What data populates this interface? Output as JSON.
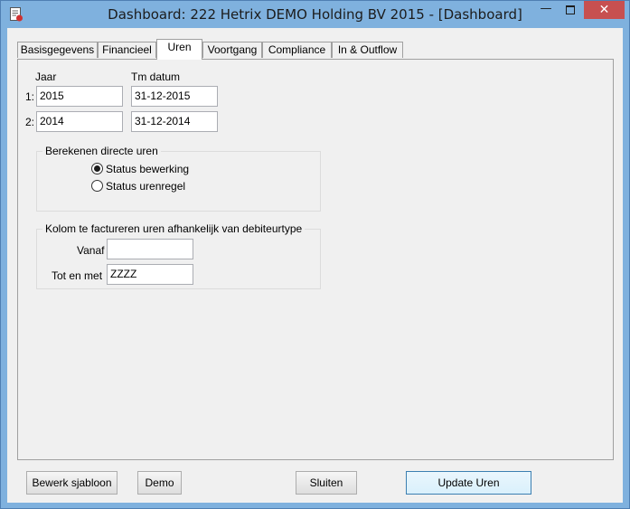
{
  "window": {
    "title": "Dashboard: 222 Hetrix DEMO Holding BV 2015 - [Dashboard]",
    "minimize_glyph": "—",
    "close_glyph": "✕"
  },
  "tabs": [
    {
      "label": "Basisgegevens",
      "active": false
    },
    {
      "label": "Financieel",
      "active": false
    },
    {
      "label": "Uren",
      "active": true
    },
    {
      "label": "Voortgang",
      "active": false
    },
    {
      "label": "Compliance",
      "active": false
    },
    {
      "label": "In & Outflow",
      "active": false
    }
  ],
  "uren": {
    "jaar_label": "Jaar",
    "tm_label": "Tm datum",
    "rows": [
      {
        "index": "1:",
        "jaar": "2015",
        "tm": "31-12-2015"
      },
      {
        "index": "2:",
        "jaar": "2014",
        "tm": "31-12-2014"
      }
    ],
    "berekenen": {
      "legend": "Berekenen directe uren",
      "options": [
        {
          "label": "Status bewerking",
          "checked": true
        },
        {
          "label": "Status urenregel",
          "checked": false
        }
      ]
    },
    "kolom": {
      "legend": "Kolom te factureren uren afhankelijk van debiteurtype",
      "vanaf_label": "Vanaf",
      "vanaf_value": "",
      "tot_label": "Tot en met",
      "tot_value": "ZZZZ"
    }
  },
  "buttons": {
    "bewerk": "Bewerk sjabloon",
    "demo": "Demo",
    "sluiten": "Sluiten",
    "update": "Update Uren"
  }
}
